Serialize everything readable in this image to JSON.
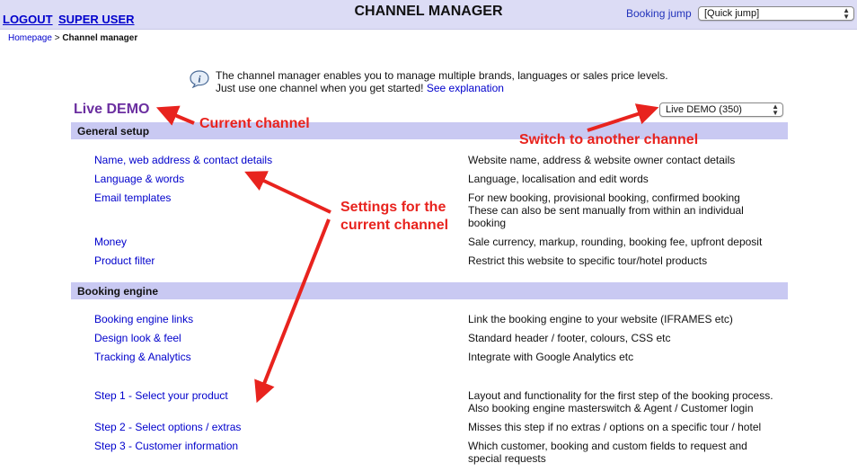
{
  "header": {
    "logout": "LOGOUT",
    "user": "SUPER USER",
    "title": "CHANNEL MANAGER",
    "booking_jump_label": "Booking jump",
    "quick_jump_value": "[Quick jump]"
  },
  "breadcrumb": {
    "home": "Homepage",
    "sep": ">",
    "current": "Channel manager"
  },
  "intro": {
    "line1": "The channel manager enables you to manage multiple brands, languages or sales price levels.",
    "line2": "Just use one channel when you get started!",
    "link": "See explanation"
  },
  "channel": {
    "current": "Live DEMO",
    "select_value": "Live DEMO (350)"
  },
  "sections": [
    {
      "title": "General setup",
      "rows": [
        {
          "label": "Name, web address & contact details",
          "desc": "Website name, address & website owner contact details"
        },
        {
          "label": "Language & words",
          "desc": "Language, localisation and edit words"
        },
        {
          "label": "Email templates",
          "desc": "For new booking, provisional booking, confirmed booking These can also be sent manually from within an individual booking"
        },
        {
          "label": "Money",
          "desc": "Sale currency, markup, rounding, booking fee, upfront deposit"
        },
        {
          "label": "Product filter",
          "desc": "Restrict this website to specific tour/hotel products"
        }
      ]
    },
    {
      "title": "Booking engine",
      "rows": [
        {
          "label": "Booking engine links",
          "desc": "Link the booking engine to your website (IFRAMES etc)"
        },
        {
          "label": "Design look & feel",
          "desc": "Standard header / footer, colours, CSS etc"
        },
        {
          "label": "Tracking & Analytics",
          "desc": "Integrate with Google Analytics etc"
        },
        {
          "label": "Step 1 - Select your product",
          "desc": "Layout and functionality for the first step of the booking process. Also booking engine masterswitch & Agent / Customer login"
        },
        {
          "label": "Step 2 - Select options / extras",
          "desc": "Misses this step if no extras / options on a specific tour / hotel"
        },
        {
          "label": "Step 3 - Customer information",
          "desc": "Which customer, booking and custom fields to request and special requests"
        }
      ]
    }
  ],
  "annotations": {
    "current_channel": "Current channel",
    "switch_channel": "Switch to another channel",
    "settings_line1": "Settings for the",
    "settings_line2": "current channel"
  },
  "colors": {
    "header_bg": "#dcdcf5",
    "section_bg": "#c9c9f2",
    "link": "#0000cc",
    "channel_name": "#6b2fa0",
    "annotation": "#e8231e"
  }
}
